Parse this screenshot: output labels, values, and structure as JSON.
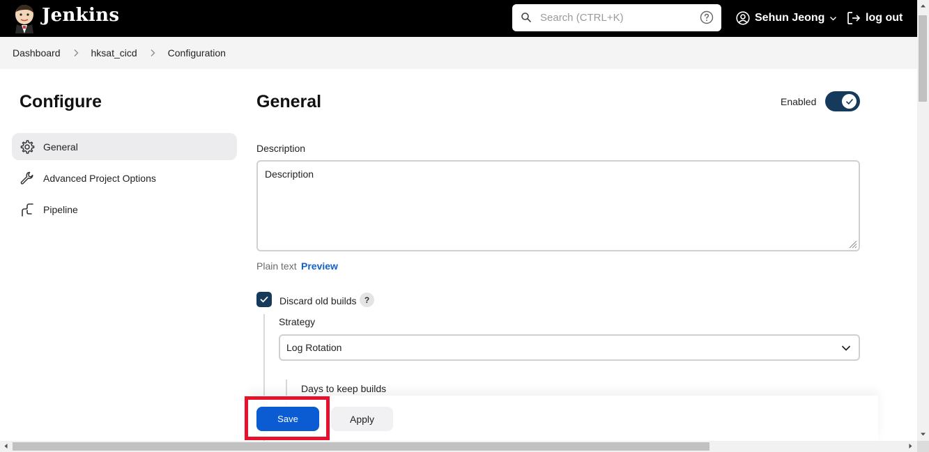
{
  "header": {
    "brand": "Jenkins",
    "search_placeholder": "Search (CTRL+K)",
    "user_name": "Sehun Jeong",
    "logout_label": "log out"
  },
  "breadcrumb": {
    "items": [
      "Dashboard",
      "hksat_cicd",
      "Configuration"
    ]
  },
  "sidebar": {
    "title": "Configure",
    "items": [
      {
        "label": "General",
        "icon": "gear-icon",
        "active": true
      },
      {
        "label": "Advanced Project Options",
        "icon": "wrench-icon",
        "active": false
      },
      {
        "label": "Pipeline",
        "icon": "pipeline-icon",
        "active": false
      }
    ]
  },
  "main": {
    "title": "General",
    "enabled_label": "Enabled",
    "enabled": true,
    "description_label": "Description",
    "description_value": "Description",
    "plain_text_label": "Plain text",
    "preview_label": "Preview",
    "discard_label": "Discard old builds",
    "discard_checked": true,
    "help_label": "?",
    "strategy_label": "Strategy",
    "strategy_value": "Log Rotation",
    "days_label": "Days to keep builds"
  },
  "actions": {
    "save_label": "Save",
    "apply_label": "Apply"
  },
  "colors": {
    "header_bg": "#000000",
    "accent": "#163a5c",
    "primary_button": "#0b5bd3",
    "highlight": "#e8112d",
    "link": "#1461c6"
  }
}
